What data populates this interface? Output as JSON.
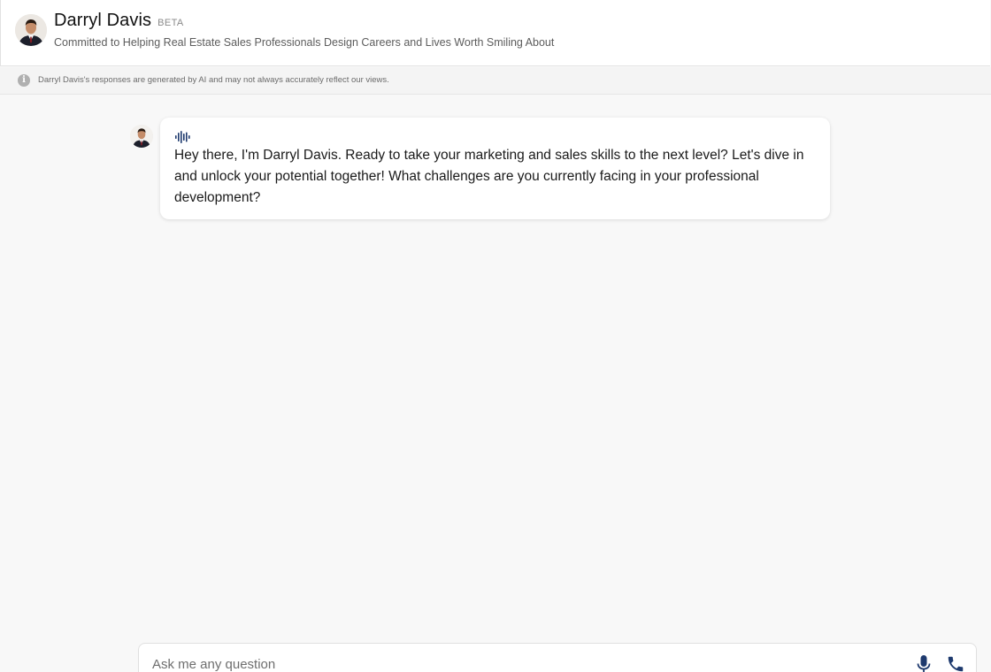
{
  "header": {
    "name": "Darryl Davis",
    "badge": "BETA",
    "tagline": "Committed to Helping Real Estate Sales Professionals Design Careers and Lives Worth Smiling About",
    "avatar_icon": "profile-photo"
  },
  "disclaimer": {
    "icon": "info-icon",
    "text": "Darryl Davis's responses are generated by AI and may not always accurately reflect our views."
  },
  "messages": [
    {
      "sender": "assistant",
      "audio_icon": "audio-waveform-icon",
      "text": "Hey there, I'm Darryl Davis. Ready to take your marketing and sales skills to the next level? Let's dive in and unlock your potential together! What challenges are you currently facing in your professional development?"
    }
  ],
  "composer": {
    "placeholder": "Ask me any question",
    "value": "",
    "mic_icon": "microphone-icon",
    "call_icon": "phone-icon"
  },
  "colors": {
    "accent": "#1e3a6e",
    "background": "#f8f8f8",
    "surface": "#ffffff"
  }
}
